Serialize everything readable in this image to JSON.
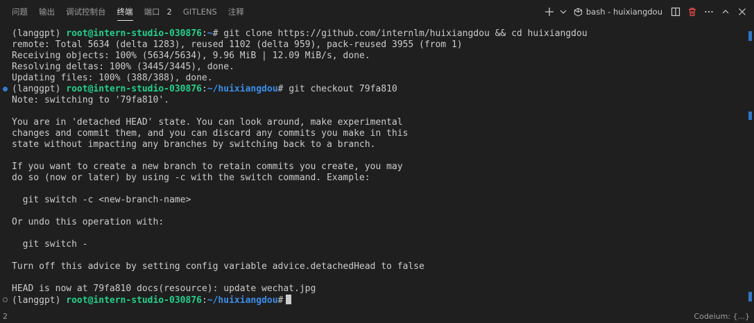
{
  "tabs": [
    {
      "label": "问题",
      "active": false
    },
    {
      "label": "输出",
      "active": false
    },
    {
      "label": "调试控制台",
      "active": false
    },
    {
      "label": "终端",
      "active": true
    },
    {
      "label": "端口",
      "active": false,
      "count": "2"
    },
    {
      "label": "GITLENS",
      "active": false
    },
    {
      "label": "注释",
      "active": false
    }
  ],
  "terminal_name": "bash - huixiangdou",
  "prompts": {
    "env": "(langgpt)",
    "user_host": "root@intern-studio-030876",
    "path_home": "~",
    "path_repo": "~/huixiangdou"
  },
  "commands": {
    "clone": "git clone https://github.com/internlm/huixiangdou && cd huixiangdou",
    "checkout": "git checkout 79fa810"
  },
  "clone_output": [
    "remote: Total 5634 (delta 1283), reused 1102 (delta 959), pack-reused 3955 (from 1)",
    "Receiving objects: 100% (5634/5634), 9.96 MiB | 12.09 MiB/s, done.",
    "Resolving deltas: 100% (3445/3445), done.",
    "Updating files: 100% (388/388), done."
  ],
  "checkout_output": [
    "Note: switching to '79fa810'.",
    "",
    "You are in 'detached HEAD' state. You can look around, make experimental",
    "changes and commit them, and you can discard any commits you make in this",
    "state without impacting any branches by switching back to a branch.",
    "",
    "If you want to create a new branch to retain commits you create, you may",
    "do so (now or later) by using -c with the switch command. Example:",
    "",
    "  git switch -c <new-branch-name>",
    "",
    "Or undo this operation with:",
    "",
    "  git switch -",
    "",
    "Turn off this advice by setting config variable advice.detachedHead to false",
    "",
    "HEAD is now at 79fa810 docs(resource): update wechat.jpg"
  ],
  "status": {
    "left": "2",
    "right": "Codeium: {...}"
  },
  "colors": {
    "background": "#1f1f1f",
    "prompt_user": "#23d18b",
    "prompt_path": "#3b8eea",
    "accent": "#3794ff"
  }
}
